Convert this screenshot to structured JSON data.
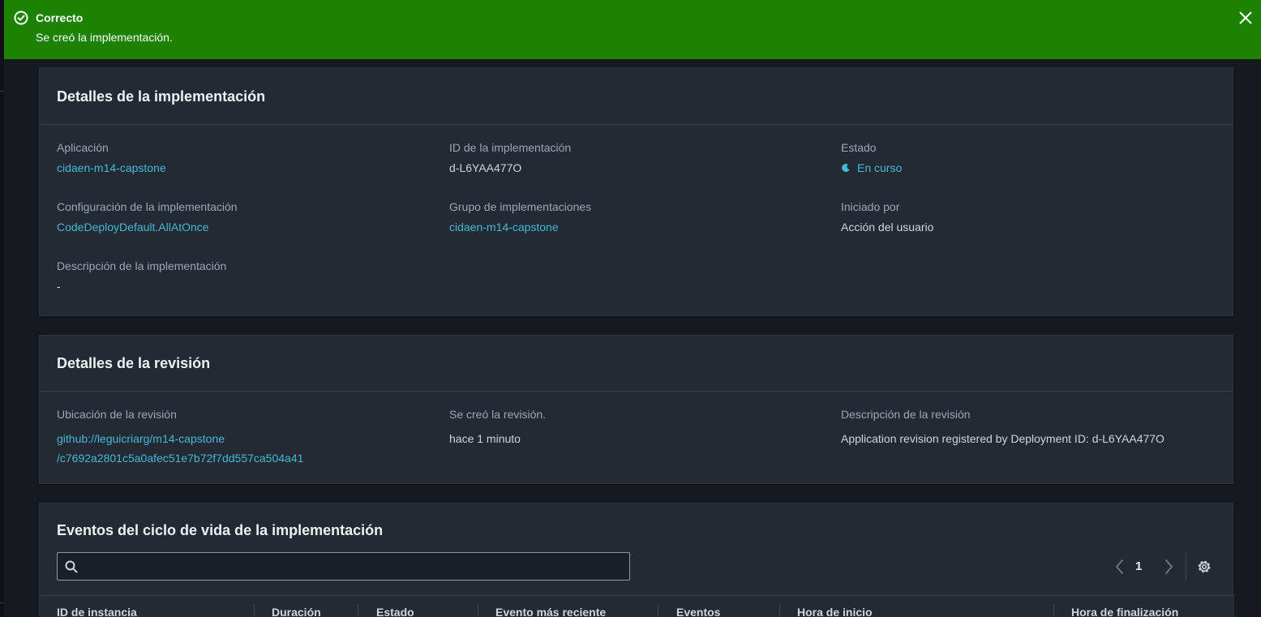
{
  "flash": {
    "type": "success",
    "title": "Correcto",
    "message": "Se creó la implementación.",
    "color": "#1d8102",
    "icon": "check-circle-icon",
    "close_icon": "close-icon"
  },
  "deployment_details": {
    "header": "Detalles de la implementación",
    "fields": {
      "application": {
        "label": "Aplicación",
        "value": "cidaen-m14-capstone"
      },
      "deployment_id": {
        "label": "ID de la implementación",
        "value": "d-L6YAA477O"
      },
      "status": {
        "label": "Estado",
        "value": "En curso",
        "icon": "spinner-icon"
      },
      "deployment_config": {
        "label": "Configuración de la implementación",
        "value": "CodeDeployDefault.AllAtOnce"
      },
      "deployment_group": {
        "label": "Grupo de implementaciones",
        "value": "cidaen-m14-capstone"
      },
      "initiated_by": {
        "label": "Iniciado por",
        "value": "Acción del usuario"
      },
      "description": {
        "label": "Descripción de la implementación",
        "value": "-"
      }
    }
  },
  "revision_details": {
    "header": "Detalles de la revisión",
    "fields": {
      "location": {
        "label": "Ubicación de la revisión",
        "line1": "github://leguicriarg/m14-capstone",
        "line2": "/c7692a2801c5a0afec51e7b72f7dd557ca504a41"
      },
      "created": {
        "label": "Se creó la revisión.",
        "value": "hace 1 minuto"
      },
      "description": {
        "label": "Descripción de la revisión",
        "value": "Application revision registered by Deployment ID: d-L6YAA477O"
      }
    }
  },
  "lifecycle_events": {
    "header": "Eventos del ciclo de vida de la implementación",
    "search": {
      "placeholder": "",
      "value": ""
    },
    "pagination": {
      "current_page": "1"
    },
    "columns": [
      "ID de instancia",
      "Duración",
      "Estado",
      "Evento más reciente",
      "Eventos",
      "Hora de inicio",
      "Hora de finalización"
    ]
  },
  "colors": {
    "link": "#44b9d6",
    "label": "#9ba7b6",
    "panel_bg": "#232a33",
    "page_bg": "#16191f"
  }
}
